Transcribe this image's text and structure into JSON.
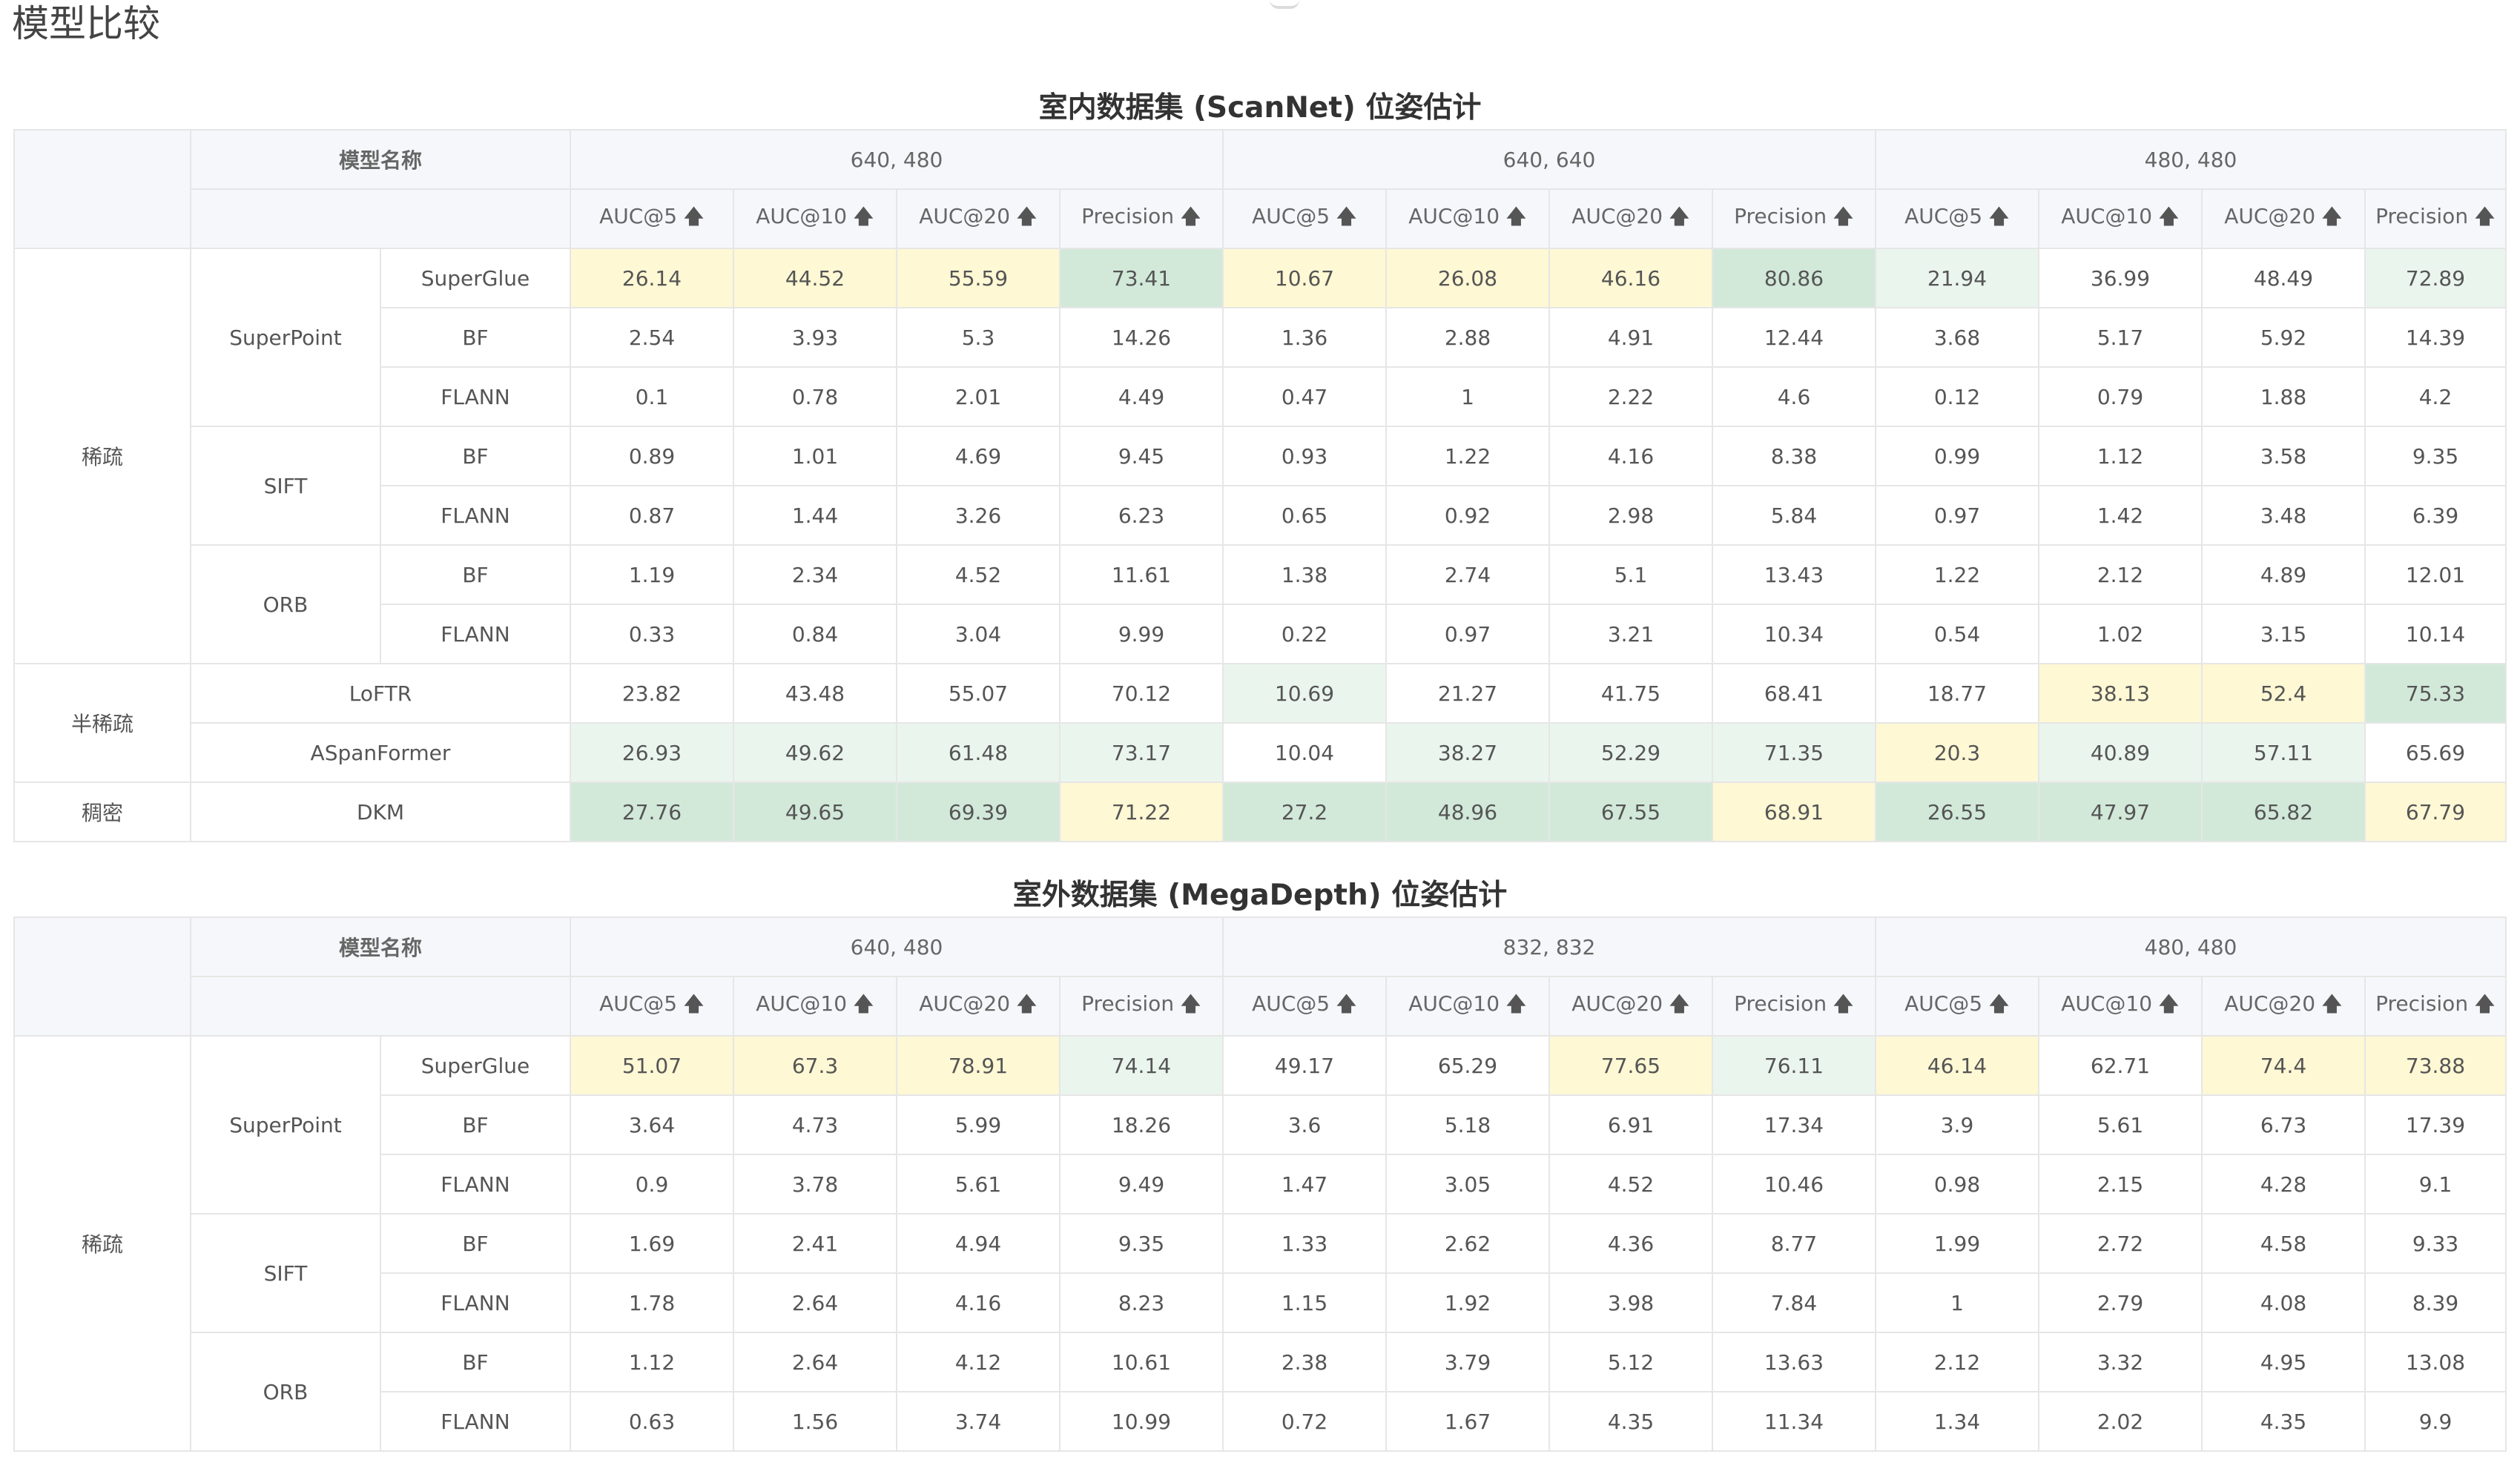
{
  "page": {
    "title": "模型比较"
  },
  "colors": {
    "highlight_strong": "#d2e9da",
    "highlight_light": "#eaf5ee",
    "highlight_yellow": "#fef8d4",
    "header_bg": "#f5f7fa"
  },
  "sections": [
    {
      "title": "室内数据集 (ScanNet) 位姿估计",
      "model_name_label": "模型名称",
      "resolutions": [
        "640, 480",
        "640, 640",
        "480, 480"
      ],
      "metrics": [
        "AUC@5",
        "AUC@10",
        "AUC@20",
        "Precision"
      ],
      "rows": [
        {
          "values": [
            "26.14",
            "44.52",
            "55.59",
            "73.41",
            "10.67",
            "26.08",
            "46.16",
            "80.86",
            "21.94",
            "36.99",
            "48.49",
            "72.89"
          ],
          "hl": [
            "yl",
            "yl",
            "yl",
            "gd",
            "yl",
            "yl",
            "yl",
            "gd",
            "gl",
            "",
            "",
            "gl"
          ]
        },
        {
          "values": [
            "2.54",
            "3.93",
            "5.3",
            "14.26",
            "1.36",
            "2.88",
            "4.91",
            "12.44",
            "3.68",
            "5.17",
            "5.92",
            "14.39"
          ],
          "hl": [
            "",
            "",
            "",
            "",
            "",
            "",
            "",
            "",
            "",
            "",
            "",
            ""
          ]
        },
        {
          "values": [
            "0.1",
            "0.78",
            "2.01",
            "4.49",
            "0.47",
            "1",
            "2.22",
            "4.6",
            "0.12",
            "0.79",
            "1.88",
            "4.2"
          ],
          "hl": [
            "",
            "",
            "",
            "",
            "",
            "",
            "",
            "",
            "",
            "",
            "",
            ""
          ]
        },
        {
          "values": [
            "0.89",
            "1.01",
            "4.69",
            "9.45",
            "0.93",
            "1.22",
            "4.16",
            "8.38",
            "0.99",
            "1.12",
            "3.58",
            "9.35"
          ],
          "hl": [
            "",
            "",
            "",
            "",
            "",
            "",
            "",
            "",
            "",
            "",
            "",
            ""
          ]
        },
        {
          "values": [
            "0.87",
            "1.44",
            "3.26",
            "6.23",
            "0.65",
            "0.92",
            "2.98",
            "5.84",
            "0.97",
            "1.42",
            "3.48",
            "6.39"
          ],
          "hl": [
            "",
            "",
            "",
            "",
            "",
            "",
            "",
            "",
            "",
            "",
            "",
            ""
          ]
        },
        {
          "values": [
            "1.19",
            "2.34",
            "4.52",
            "11.61",
            "1.38",
            "2.74",
            "5.1",
            "13.43",
            "1.22",
            "2.12",
            "4.89",
            "12.01"
          ],
          "hl": [
            "",
            "",
            "",
            "",
            "",
            "",
            "",
            "",
            "",
            "",
            "",
            ""
          ]
        },
        {
          "values": [
            "0.33",
            "0.84",
            "3.04",
            "9.99",
            "0.22",
            "0.97",
            "3.21",
            "10.34",
            "0.54",
            "1.02",
            "3.15",
            "10.14"
          ],
          "hl": [
            "",
            "",
            "",
            "",
            "",
            "",
            "",
            "",
            "",
            "",
            "",
            ""
          ]
        },
        {
          "values": [
            "23.82",
            "43.48",
            "55.07",
            "70.12",
            "10.69",
            "21.27",
            "41.75",
            "68.41",
            "18.77",
            "38.13",
            "52.4",
            "75.33"
          ],
          "hl": [
            "",
            "",
            "",
            "",
            "gl",
            "",
            "",
            "",
            "",
            "yl",
            "yl",
            "gd"
          ]
        },
        {
          "values": [
            "26.93",
            "49.62",
            "61.48",
            "73.17",
            "10.04",
            "38.27",
            "52.29",
            "71.35",
            "20.3",
            "40.89",
            "57.11",
            "65.69"
          ],
          "hl": [
            "gl",
            "gl",
            "gl",
            "gl",
            "",
            "gl",
            "gl",
            "gl",
            "yl",
            "gl",
            "gl",
            ""
          ]
        },
        {
          "values": [
            "27.76",
            "49.65",
            "69.39",
            "71.22",
            "27.2",
            "48.96",
            "67.55",
            "68.91",
            "26.55",
            "47.97",
            "65.82",
            "67.79"
          ],
          "hl": [
            "gd",
            "gd",
            "gd",
            "yl",
            "gd",
            "gd",
            "gd",
            "yl",
            "gd",
            "gd",
            "gd",
            "yl"
          ]
        }
      ]
    },
    {
      "title": "室外数据集 (MegaDepth) 位姿估计",
      "model_name_label": "模型名称",
      "resolutions": [
        "640, 480",
        "832, 832",
        "480, 480"
      ],
      "metrics": [
        "AUC@5",
        "AUC@10",
        "AUC@20",
        "Precision"
      ],
      "rows": [
        {
          "values": [
            "51.07",
            "67.3",
            "78.91",
            "74.14",
            "49.17",
            "65.29",
            "77.65",
            "76.11",
            "46.14",
            "62.71",
            "74.4",
            "73.88"
          ],
          "hl": [
            "yl",
            "yl",
            "yl",
            "gl",
            "",
            "",
            "yl",
            "gl",
            "yl",
            "",
            "yl",
            "yl"
          ]
        },
        {
          "values": [
            "3.64",
            "4.73",
            "5.99",
            "18.26",
            "3.6",
            "5.18",
            "6.91",
            "17.34",
            "3.9",
            "5.61",
            "6.73",
            "17.39"
          ],
          "hl": [
            "",
            "",
            "",
            "",
            "",
            "",
            "",
            "",
            "",
            "",
            "",
            ""
          ]
        },
        {
          "values": [
            "0.9",
            "3.78",
            "5.61",
            "9.49",
            "1.47",
            "3.05",
            "4.52",
            "10.46",
            "0.98",
            "2.15",
            "4.28",
            "9.1"
          ],
          "hl": [
            "",
            "",
            "",
            "",
            "",
            "",
            "",
            "",
            "",
            "",
            "",
            ""
          ]
        },
        {
          "values": [
            "1.69",
            "2.41",
            "4.94",
            "9.35",
            "1.33",
            "2.62",
            "4.36",
            "8.77",
            "1.99",
            "2.72",
            "4.58",
            "9.33"
          ],
          "hl": [
            "",
            "",
            "",
            "",
            "",
            "",
            "",
            "",
            "",
            "",
            "",
            ""
          ]
        },
        {
          "values": [
            "1.78",
            "2.64",
            "4.16",
            "8.23",
            "1.15",
            "1.92",
            "3.98",
            "7.84",
            "1",
            "2.79",
            "4.08",
            "8.39"
          ],
          "hl": [
            "",
            "",
            "",
            "",
            "",
            "",
            "",
            "",
            "",
            "",
            "",
            ""
          ]
        },
        {
          "values": [
            "1.12",
            "2.64",
            "4.12",
            "10.61",
            "2.38",
            "3.79",
            "5.12",
            "13.63",
            "2.12",
            "3.32",
            "4.95",
            "13.08"
          ],
          "hl": [
            "",
            "",
            "",
            "",
            "",
            "",
            "",
            "",
            "",
            "",
            "",
            ""
          ]
        },
        {
          "values": [
            "0.63",
            "1.56",
            "3.74",
            "10.99",
            "0.72",
            "1.67",
            "4.35",
            "11.34",
            "1.34",
            "2.02",
            "4.35",
            "9.9"
          ],
          "hl": [
            "",
            "",
            "",
            "",
            "",
            "",
            "",
            "",
            "",
            "",
            "",
            ""
          ]
        }
      ]
    }
  ],
  "row_labels": {
    "category_sparse": "稀疏",
    "category_semi": "半稀疏",
    "category_dense": "稠密",
    "superpoint": "SuperPoint",
    "sift": "SIFT",
    "orb": "ORB",
    "superglue": "SuperGlue",
    "bf": "BF",
    "flann": "FLANN",
    "loftr": "LoFTR",
    "aspanformer": "ASpanFormer",
    "dkm": "DKM"
  }
}
